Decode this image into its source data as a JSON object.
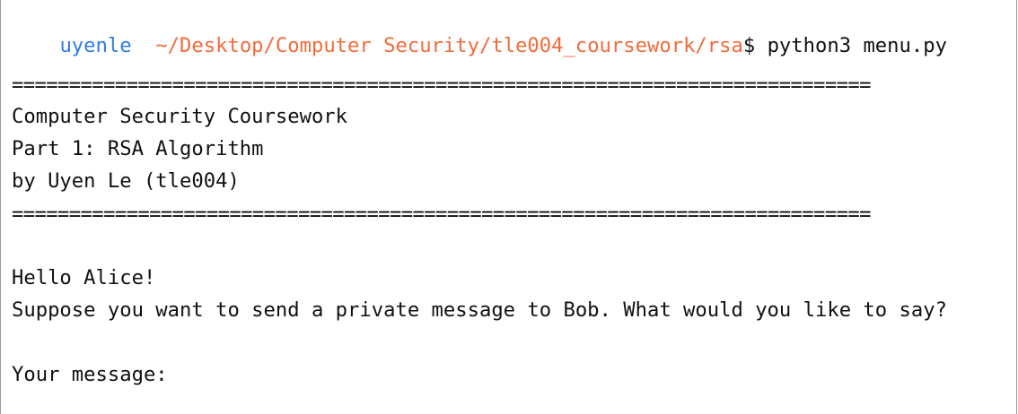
{
  "prompt": {
    "user": "uyenle",
    "path": "~/Desktop/Computer Security/tle004_coursework/rsa",
    "symbol": "$",
    "command": " python3 menu.py"
  },
  "banner": {
    "rule_top": "===========================================================================",
    "title": "Computer Security Coursework",
    "part": "Part 1: RSA Algorithm",
    "author": "by Uyen Le (tle004)",
    "rule_bottom": "==========================================================================="
  },
  "dialog": {
    "greeting": "Hello Alice!",
    "question": "Suppose you want to send a private message to Bob. What would you like to say?",
    "input_label": "Your message:"
  },
  "colors": {
    "user": "#2f7de1",
    "path": "#f26b3a",
    "text": "#111111"
  }
}
